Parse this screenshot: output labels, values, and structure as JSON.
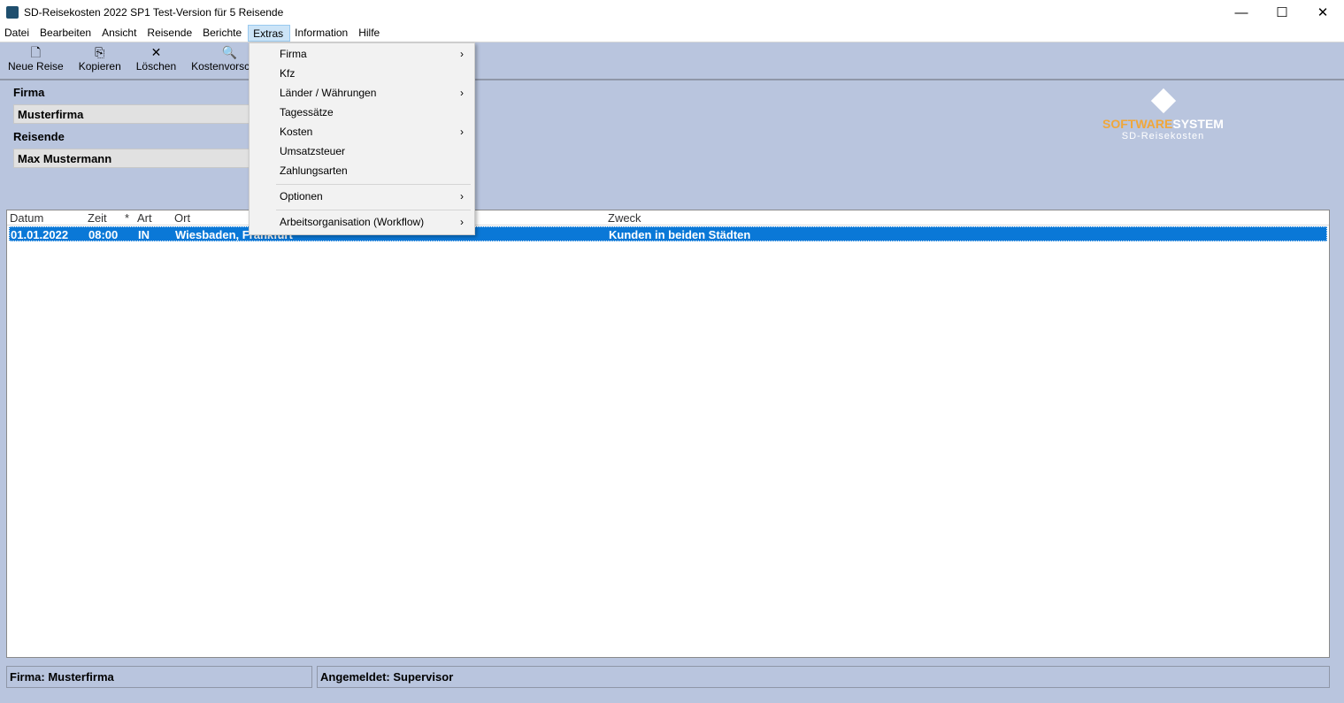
{
  "window": {
    "title": "SD-Reisekosten 2022 SP1 Test-Version für 5 Reisende",
    "minimize": "—",
    "maximize": "☐",
    "close": "✕"
  },
  "menubar": [
    "Datei",
    "Bearbeiten",
    "Ansicht",
    "Reisende",
    "Berichte",
    "Extras",
    "Information",
    "Hilfe"
  ],
  "toolbar": [
    {
      "label": "Neue Reise",
      "icon": "🗋"
    },
    {
      "label": "Kopieren",
      "icon": "⎘"
    },
    {
      "label": "Löschen",
      "icon": "✕"
    },
    {
      "label": "Kostenvorschau",
      "icon": "🔍"
    }
  ],
  "form": {
    "firma_label": "Firma",
    "firma_value": "Musterfirma",
    "reisende_label": "Reisende",
    "reisende_value": "Max Mustermann"
  },
  "logo": {
    "brand_a": "SOFTWARE",
    "brand_b": "SYSTEM",
    "sub": "SD-Reisekosten",
    "colors": {
      "brand_a": "#f0a73a",
      "brand_b": "#ffffff"
    }
  },
  "table": {
    "columns": [
      "Datum",
      "Zeit",
      "*",
      "Art",
      "Ort",
      "Zweck"
    ],
    "rows": [
      {
        "datum": "01.01.2022",
        "zeit": "08:00",
        "star": "",
        "art": "IN",
        "ort": "Wiesbaden, Frankfurt",
        "zweck": "Kunden in beiden Städten"
      }
    ]
  },
  "status": {
    "firma": "Firma: Musterfirma",
    "user": "Angemeldet: Supervisor"
  },
  "extras_menu": [
    "Firma",
    "Kfz",
    "Länder / Währungen",
    "Tagessätze",
    "Kosten",
    "Umsatzsteuer",
    "Zahlungsarten",
    "Optionen",
    "Arbeitsorganisation (Workflow)"
  ],
  "submenu_arrow": "›"
}
